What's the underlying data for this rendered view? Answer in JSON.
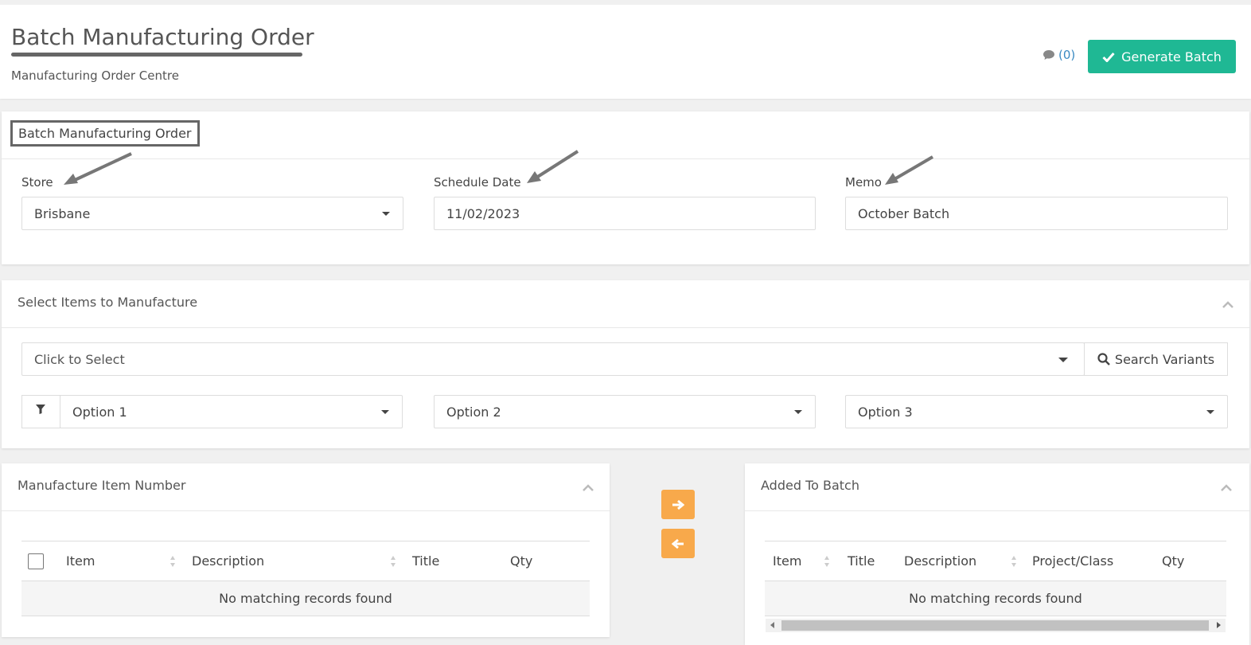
{
  "header": {
    "title": "Batch Manufacturing Order",
    "subtitle": "Manufacturing Order Centre",
    "comments_count": "(0)",
    "generate_label": "Generate Batch"
  },
  "order_panel": {
    "title": "Batch Manufacturing Order",
    "store_label": "Store",
    "store_value": "Brisbane",
    "schedule_label": "Schedule Date",
    "schedule_value": "11/02/2023",
    "memo_label": "Memo",
    "memo_value": "October Batch"
  },
  "select_panel": {
    "title": "Select Items to Manufacture",
    "select_placeholder": "Click to Select",
    "search_label": "Search Variants",
    "option1": "Option 1",
    "option2": "Option 2",
    "option3": "Option 3"
  },
  "left_table": {
    "title": "Manufacture Item Number",
    "columns": [
      "Item",
      "Description",
      "Title",
      "Qty"
    ],
    "empty_text": "No matching records found"
  },
  "right_table": {
    "title": "Added To Batch",
    "columns": [
      "Item",
      "Title",
      "Description",
      "Project/Class",
      "Qty"
    ],
    "empty_text": "No matching records found"
  },
  "colors": {
    "accent_green": "#1fb894",
    "move_orange": "#f8a94b",
    "link_blue": "#3a8ac2"
  },
  "icons": [
    "comment-icon",
    "check-icon",
    "search-icon",
    "filter-icon",
    "arrow-right-icon",
    "arrow-left-icon",
    "chevron-up-icon",
    "sort-icon"
  ]
}
